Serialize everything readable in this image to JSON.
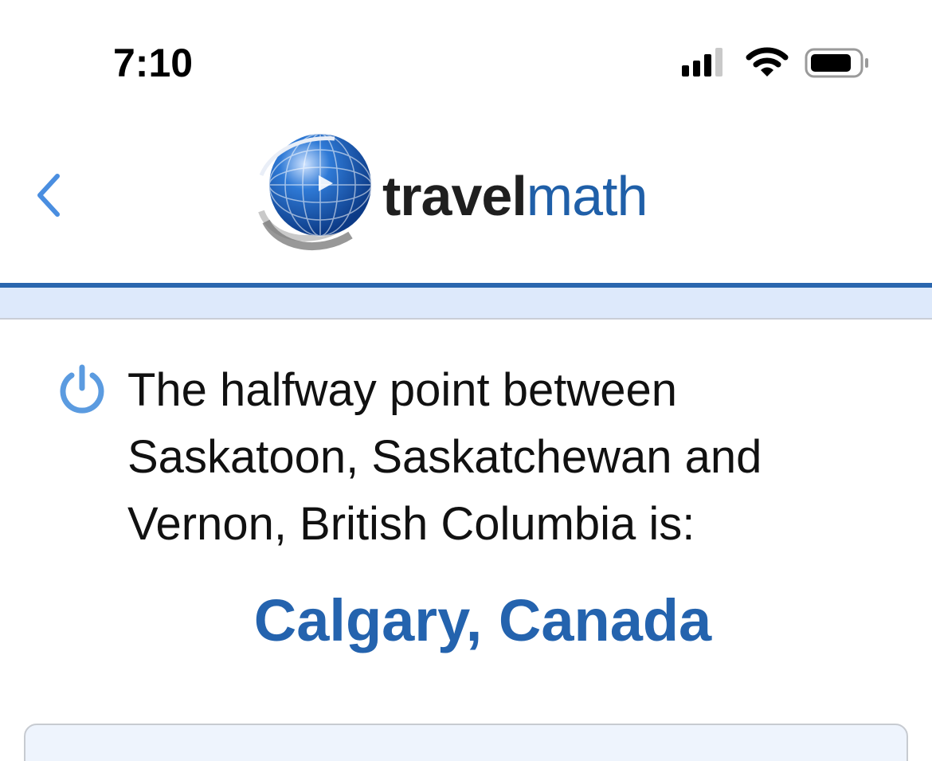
{
  "status_bar": {
    "time": "7:10",
    "icons": [
      "cellular-signal-icon",
      "wifi-icon",
      "battery-icon"
    ]
  },
  "header": {
    "back_icon": "chevron-left-icon",
    "logo": {
      "word_bold": "travel",
      "word_light": "math",
      "globe_icon": "globe-icon"
    }
  },
  "content": {
    "headline_icon": "power-icon",
    "headline": "The halfway point between Saskatoon, Saskatchewan and Vernon, British Columbia is:",
    "result": "Calgary, Canada"
  },
  "colors": {
    "accent_blue": "#2463ae",
    "rule_blue": "#2a66ae",
    "band_blue": "#dde9fb",
    "icon_blue": "#5b9be0",
    "logo_math": "#1f5fa8"
  }
}
